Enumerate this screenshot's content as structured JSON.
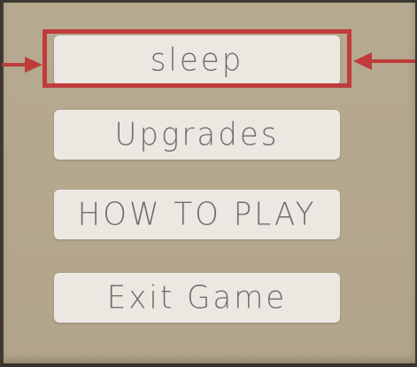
{
  "menu": {
    "items": [
      {
        "label": "sleep",
        "selected": true
      },
      {
        "label": "Upgrades",
        "selected": false
      },
      {
        "label": "HOW TO PLAY",
        "selected": false
      },
      {
        "label": "Exit Game",
        "selected": false
      }
    ]
  },
  "colors": {
    "background": "#b5a88e",
    "button_fill": "#ebe8e2",
    "button_text": "#6e6e6e",
    "selection": "#c03c3c"
  },
  "icons": {
    "left_pointer": "arrow-right-icon",
    "right_pointer": "arrow-left-icon"
  }
}
